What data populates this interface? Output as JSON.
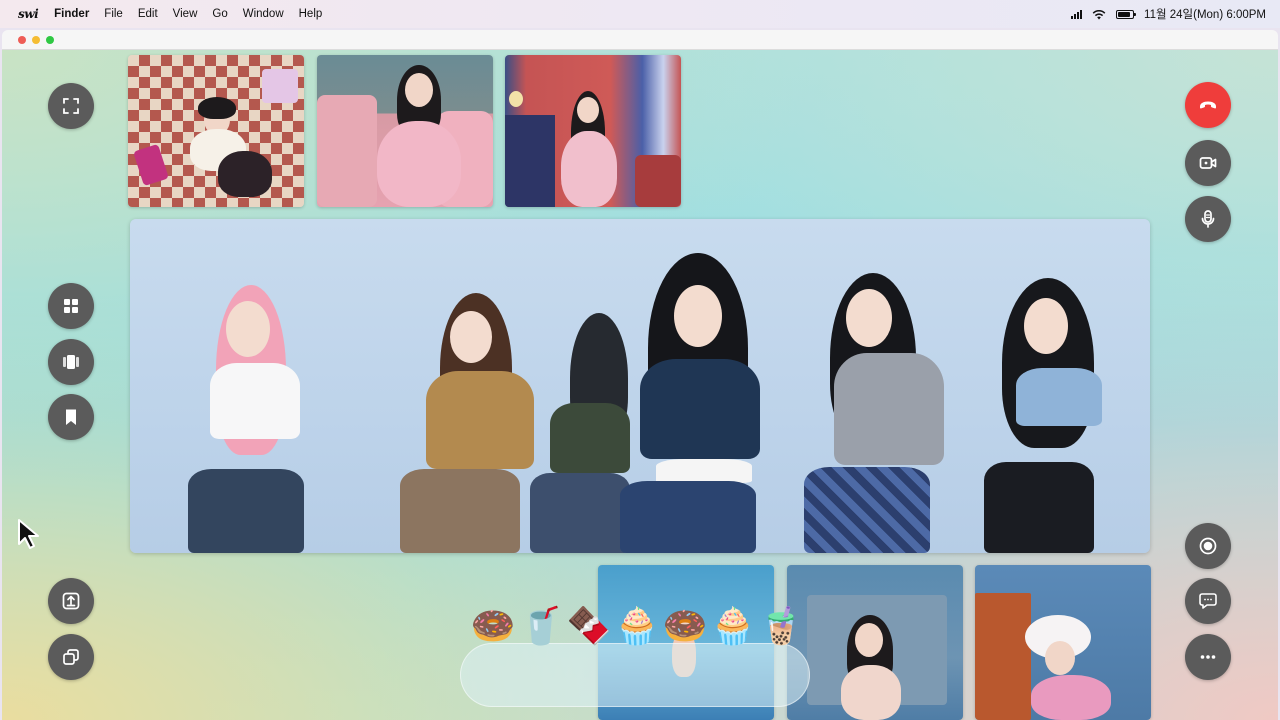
{
  "menubar": {
    "app_logo": "swi",
    "items": [
      "Finder",
      "File",
      "Edit",
      "View",
      "Go",
      "Window",
      "Help"
    ],
    "clock": "11월 24일(Mon) 6:00PM",
    "battery_level": 0.85
  },
  "window": {
    "traffic_colors": [
      "#ee5d56",
      "#f5bd33",
      "#2fc843"
    ]
  },
  "left_controls": [
    {
      "name": "fullscreen-button",
      "icon": "expand-corners-icon"
    },
    {
      "name": "grid-view-button",
      "icon": "grid-icon"
    },
    {
      "name": "filmstrip-view-button",
      "icon": "carousel-icon"
    },
    {
      "name": "bookmark-button",
      "icon": "bookmark-icon"
    },
    {
      "name": "share-screen-button",
      "icon": "upload-icon"
    },
    {
      "name": "switch-window-button",
      "icon": "windows-icon"
    }
  ],
  "right_controls": [
    {
      "name": "end-call-button",
      "icon": "phone-hangup-icon",
      "color": "#ef3d3b"
    },
    {
      "name": "camera-toggle-button",
      "icon": "video-camera-icon"
    },
    {
      "name": "microphone-toggle-button",
      "icon": "microphone-icon"
    },
    {
      "name": "record-button",
      "icon": "record-icon"
    },
    {
      "name": "chat-button",
      "icon": "chat-bubble-icon"
    },
    {
      "name": "more-options-button",
      "icon": "ellipsis-icon"
    }
  ],
  "participants_top": [
    {
      "name": "participant-tile-1",
      "scene": "checkered-floor-pink"
    },
    {
      "name": "participant-tile-2",
      "scene": "pink-bedroom"
    },
    {
      "name": "participant-tile-3",
      "scene": "red-room"
    }
  ],
  "participants_bottom": [
    {
      "name": "participant-tile-4",
      "scene": "blue-stage"
    },
    {
      "name": "participant-tile-5",
      "scene": "blue-lockers"
    },
    {
      "name": "participant-tile-6",
      "scene": "white-fur-hat"
    }
  ],
  "main_video": {
    "scene": "group-dance"
  },
  "stickers": [
    "🍩",
    "🥤",
    "🍫",
    "🧁",
    "🍩",
    "🧁",
    "🧋"
  ]
}
